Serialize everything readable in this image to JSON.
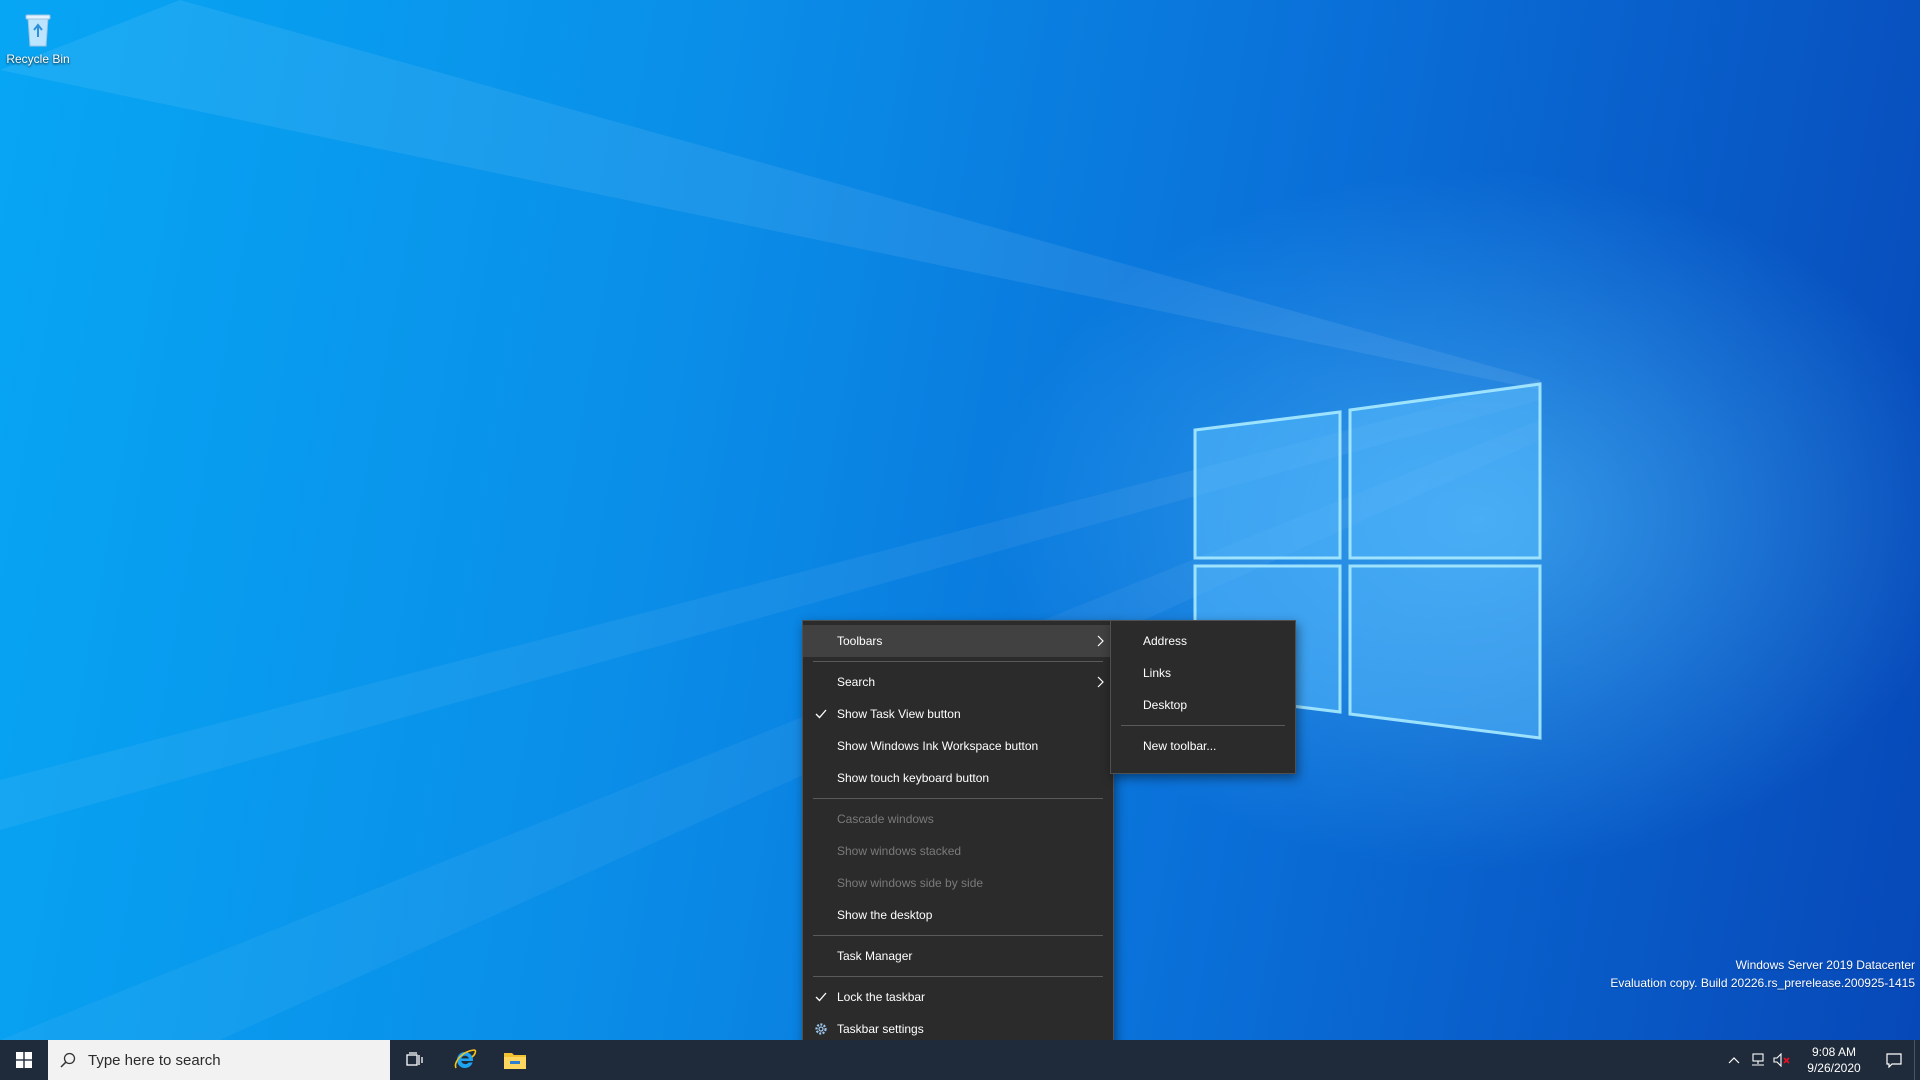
{
  "desktop": {
    "icons": [
      {
        "label": "Recycle Bin",
        "icon": "recycle-bin-icon"
      }
    ],
    "watermark": {
      "line1": "Windows Server 2019 Datacenter",
      "line2": "Evaluation copy. Build 20226.rs_prerelease.200925-1415"
    }
  },
  "context_menu": {
    "toolbars": "Toolbars",
    "search": "Search",
    "show_task_view": "Show Task View button",
    "show_ink_workspace": "Show Windows Ink Workspace button",
    "show_touch_keyboard": "Show touch keyboard button",
    "cascade_windows": "Cascade windows",
    "show_windows_stacked": "Show windows stacked",
    "show_windows_side_by_side": "Show windows side by side",
    "show_desktop": "Show the desktop",
    "task_manager": "Task Manager",
    "lock_taskbar": "Lock the taskbar",
    "taskbar_settings": "Taskbar settings"
  },
  "toolbars_submenu": {
    "address": "Address",
    "links": "Links",
    "desktop": "Desktop",
    "new_toolbar": "New toolbar..."
  },
  "taskbar": {
    "search_placeholder": "Type here to search",
    "pinned_apps": [
      "internet-explorer-icon",
      "file-explorer-icon"
    ],
    "clock": {
      "time": "9:08 AM",
      "date": "9/26/2020"
    }
  },
  "colors": {
    "menu_background": "#2b2b2b",
    "menu_hover": "#414141",
    "taskbar": "#1f2b3a",
    "wallpaper_accent": "#0a8ee8"
  }
}
